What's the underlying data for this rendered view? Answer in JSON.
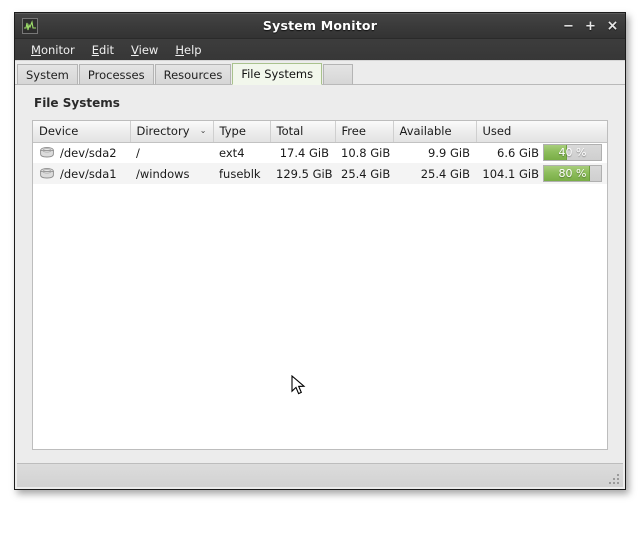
{
  "window": {
    "title": "System Monitor",
    "app_icon": "system-monitor-icon",
    "buttons": {
      "minimize": "−",
      "maximize": "+",
      "close": "×"
    }
  },
  "menubar": {
    "items": [
      {
        "label": "Monitor",
        "mnemonic": "M"
      },
      {
        "label": "Edit",
        "mnemonic": "E"
      },
      {
        "label": "View",
        "mnemonic": "V"
      },
      {
        "label": "Help",
        "mnemonic": "H"
      }
    ]
  },
  "tabs": [
    {
      "label": "System",
      "active": false
    },
    {
      "label": "Processes",
      "active": false
    },
    {
      "label": "Resources",
      "active": false
    },
    {
      "label": "File Systems",
      "active": true
    }
  ],
  "main": {
    "section_title": "File Systems",
    "table": {
      "columns": [
        {
          "label": "Device",
          "sorted": false
        },
        {
          "label": "Directory",
          "sorted": true,
          "sort_indicator": "⌄"
        },
        {
          "label": "Type",
          "sorted": false
        },
        {
          "label": "Total",
          "sorted": false
        },
        {
          "label": "Free",
          "sorted": false
        },
        {
          "label": "Available",
          "sorted": false
        },
        {
          "label": "Used",
          "sorted": false
        }
      ],
      "rows": [
        {
          "icon": "hard-disk-icon",
          "device": "/dev/sda2",
          "directory": "/",
          "type": "ext4",
          "total": "17.4 GiB",
          "free": "10.8 GiB",
          "available": "9.9 GiB",
          "used": "6.6 GiB",
          "used_percent_label": "40 %",
          "used_percent": 40
        },
        {
          "icon": "hard-disk-icon",
          "device": "/dev/sda1",
          "directory": "/windows",
          "type": "fuseblk",
          "total": "129.5 GiB",
          "free": "25.4 GiB",
          "available": "25.4 GiB",
          "used": "104.1 GiB",
          "used_percent_label": "80 %",
          "used_percent": 80
        }
      ]
    }
  },
  "statusbar": {
    "grip": "resize-grip-icon"
  },
  "colors": {
    "titlebar": "#3a3a3a",
    "panel": "#ececec",
    "progress_fill": "#8dbd5c",
    "active_tab_border": "#a9c28d",
    "active_tab_bg": "#f2f7ec"
  }
}
